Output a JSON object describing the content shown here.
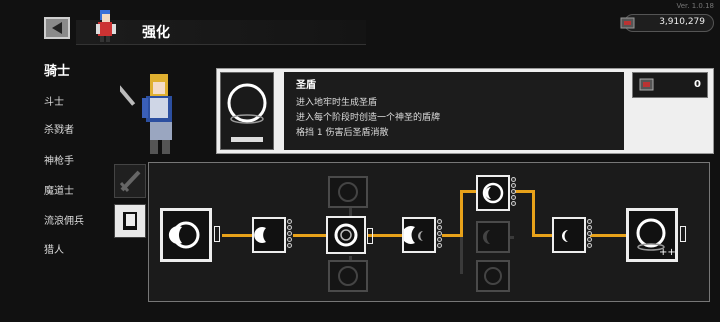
{
  "version": "Ver. 1.0.18",
  "header": {
    "title": "强化"
  },
  "currency": {
    "amount": "3,910,279"
  },
  "sidebar": {
    "items": [
      {
        "label": "骑士",
        "active": true
      },
      {
        "label": "斗士"
      },
      {
        "label": "杀戮者"
      },
      {
        "label": "神枪手"
      },
      {
        "label": "魔道士"
      },
      {
        "label": "流浪佣兵"
      },
      {
        "label": "猎人"
      }
    ]
  },
  "item": {
    "name": "圣盾",
    "desc": [
      "进入地牢时生成圣盾",
      "进入每个阶段时创造一个神圣的盾牌",
      "格挡 1 伤害后圣盾消散"
    ],
    "reward_count": "0"
  },
  "tabs": [
    "weapon-tab",
    "book-tab"
  ],
  "colors": {
    "accent_line": "#e8a21a",
    "panel_light": "#efefef",
    "background": "#111111"
  }
}
